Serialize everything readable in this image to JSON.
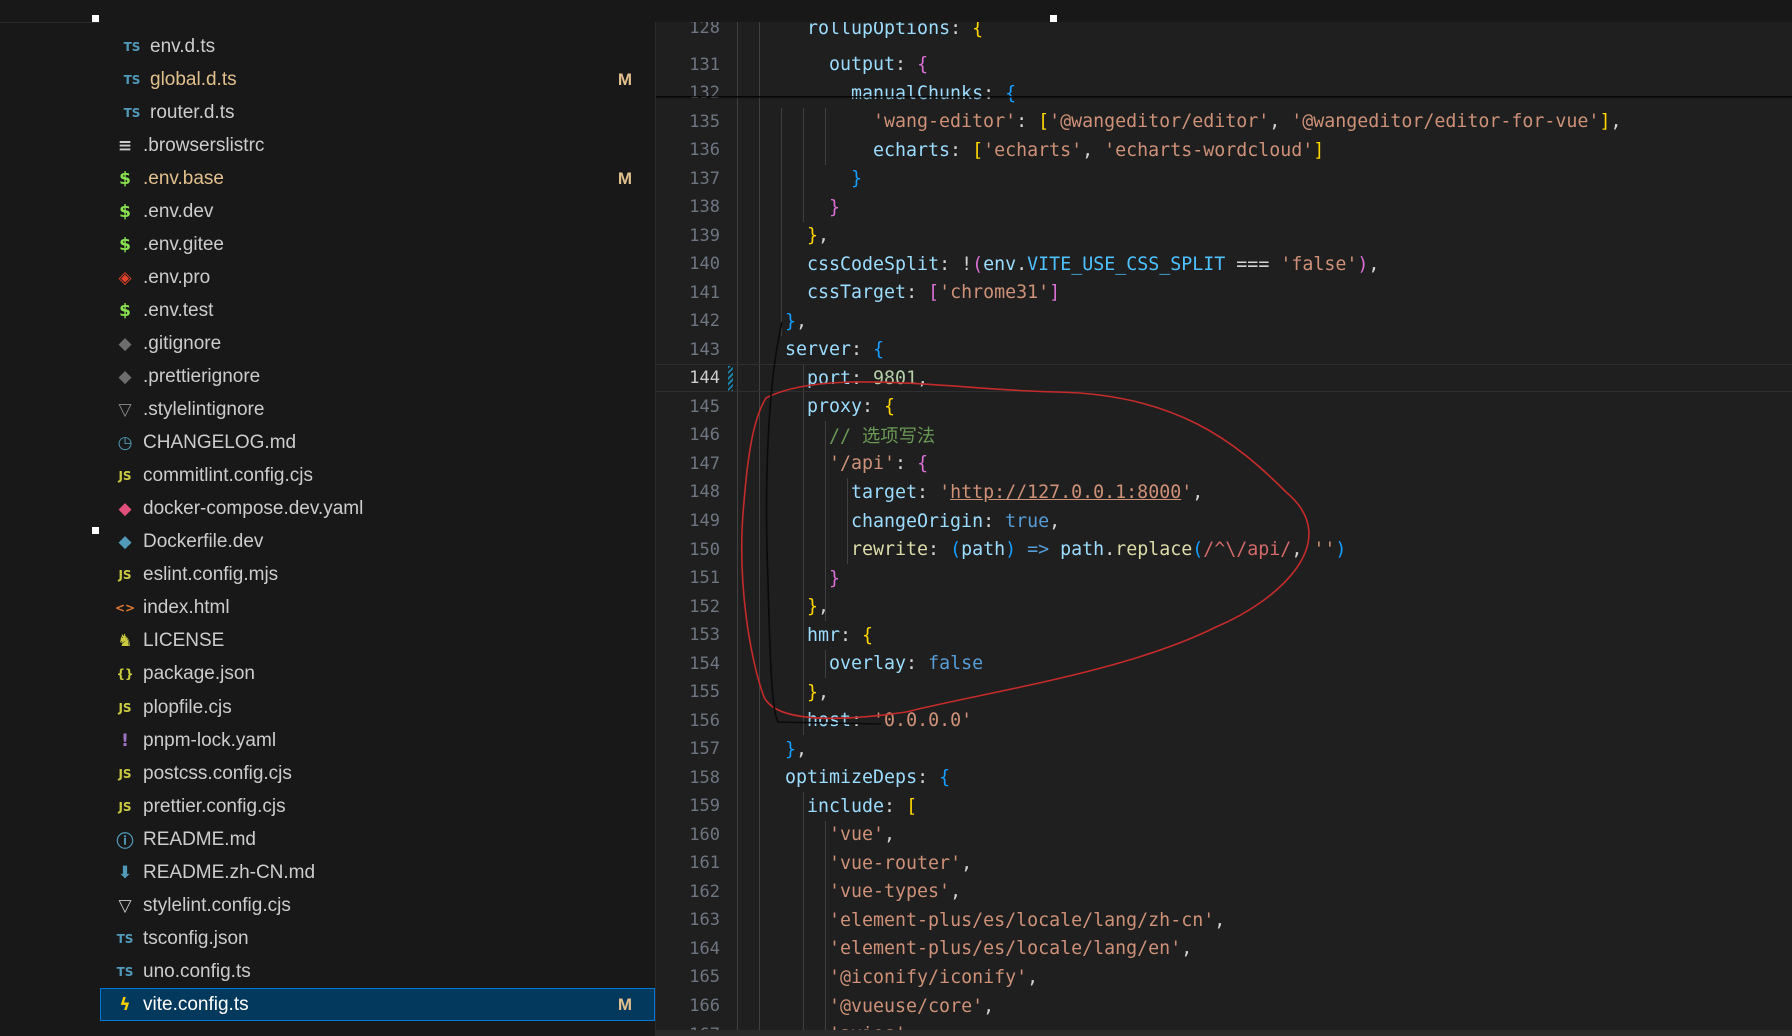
{
  "explorer": {
    "files": [
      {
        "icon": "ts-icon",
        "icon_text": "TS",
        "icon_color": "#519aba",
        "label": "env.d.ts",
        "nested": true,
        "modified": false,
        "badge": ""
      },
      {
        "icon": "ts-icon",
        "icon_text": "TS",
        "icon_color": "#519aba",
        "label": "global.d.ts",
        "nested": true,
        "modified": true,
        "badge": "M"
      },
      {
        "icon": "ts-icon",
        "icon_text": "TS",
        "icon_color": "#519aba",
        "label": "router.d.ts",
        "nested": true,
        "modified": false,
        "badge": ""
      },
      {
        "icon": "list-icon",
        "icon_text": "≡",
        "icon_color": "#cccccc",
        "label": ".browserslistrc",
        "nested": false,
        "modified": false,
        "badge": ""
      },
      {
        "icon": "dollar-icon",
        "icon_text": "$",
        "icon_color": "#89e051",
        "label": ".env.base",
        "nested": false,
        "modified": true,
        "badge": "M"
      },
      {
        "icon": "dollar-icon",
        "icon_text": "$",
        "icon_color": "#89e051",
        "label": ".env.dev",
        "nested": false,
        "modified": false,
        "badge": ""
      },
      {
        "icon": "dollar-icon",
        "icon_text": "$",
        "icon_color": "#89e051",
        "label": ".env.gitee",
        "nested": false,
        "modified": false,
        "badge": ""
      },
      {
        "icon": "gitlab-icon",
        "icon_text": "◈",
        "icon_color": "#e24329",
        "label": ".env.pro",
        "nested": false,
        "modified": false,
        "badge": ""
      },
      {
        "icon": "dollar-icon",
        "icon_text": "$",
        "icon_color": "#89e051",
        "label": ".env.test",
        "nested": false,
        "modified": false,
        "badge": ""
      },
      {
        "icon": "git-icon",
        "icon_text": "◆",
        "icon_color": "#6d6d6d",
        "label": ".gitignore",
        "nested": false,
        "modified": false,
        "badge": ""
      },
      {
        "icon": "prettier-icon",
        "icon_text": "◆",
        "icon_color": "#6d6d6d",
        "label": ".prettierignore",
        "nested": false,
        "modified": false,
        "badge": ""
      },
      {
        "icon": "stylelint-icon",
        "icon_text": "▽",
        "icon_color": "#8c8c8c",
        "label": ".stylelintignore",
        "nested": false,
        "modified": false,
        "badge": ""
      },
      {
        "icon": "history-icon",
        "icon_text": "◷",
        "icon_color": "#519aba",
        "label": "CHANGELOG.md",
        "nested": false,
        "modified": false,
        "badge": ""
      },
      {
        "icon": "js-icon",
        "icon_text": "JS",
        "icon_color": "#cbcb41",
        "label": "commitlint.config.cjs",
        "nested": false,
        "modified": false,
        "badge": ""
      },
      {
        "icon": "docker-compose-icon",
        "icon_text": "◆",
        "icon_color": "#e0507a",
        "label": "docker-compose.dev.yaml",
        "nested": false,
        "modified": false,
        "badge": ""
      },
      {
        "icon": "docker-icon",
        "icon_text": "◆",
        "icon_color": "#519aba",
        "label": "Dockerfile.dev",
        "nested": false,
        "modified": false,
        "badge": ""
      },
      {
        "icon": "js-icon",
        "icon_text": "JS",
        "icon_color": "#cbcb41",
        "label": "eslint.config.mjs",
        "nested": false,
        "modified": false,
        "badge": ""
      },
      {
        "icon": "html-icon",
        "icon_text": "<>",
        "icon_color": "#e37933",
        "label": "index.html",
        "nested": false,
        "modified": false,
        "badge": ""
      },
      {
        "icon": "license-icon",
        "icon_text": "♞",
        "icon_color": "#cbcb41",
        "label": "LICENSE",
        "nested": false,
        "modified": false,
        "badge": ""
      },
      {
        "icon": "json-icon",
        "icon_text": "{}",
        "icon_color": "#cbcb41",
        "label": "package.json",
        "nested": false,
        "modified": false,
        "badge": ""
      },
      {
        "icon": "js-icon",
        "icon_text": "JS",
        "icon_color": "#cbcb41",
        "label": "plopfile.cjs",
        "nested": false,
        "modified": false,
        "badge": ""
      },
      {
        "icon": "yaml-icon",
        "icon_text": "!",
        "icon_color": "#a074c4",
        "label": "pnpm-lock.yaml",
        "nested": false,
        "modified": false,
        "badge": ""
      },
      {
        "icon": "js-icon",
        "icon_text": "JS",
        "icon_color": "#cbcb41",
        "label": "postcss.config.cjs",
        "nested": false,
        "modified": false,
        "badge": ""
      },
      {
        "icon": "js-icon",
        "icon_text": "JS",
        "icon_color": "#cbcb41",
        "label": "prettier.config.cjs",
        "nested": false,
        "modified": false,
        "badge": ""
      },
      {
        "icon": "info-icon",
        "icon_text": "ⓘ",
        "icon_color": "#519aba",
        "label": "README.md",
        "nested": false,
        "modified": false,
        "badge": ""
      },
      {
        "icon": "download-icon",
        "icon_text": "⬇",
        "icon_color": "#519aba",
        "label": "README.zh-CN.md",
        "nested": false,
        "modified": false,
        "badge": ""
      },
      {
        "icon": "stylelint-icon",
        "icon_text": "▽",
        "icon_color": "#cccccc",
        "label": "stylelint.config.cjs",
        "nested": false,
        "modified": false,
        "badge": ""
      },
      {
        "icon": "tsconfig-icon",
        "icon_text": "TS",
        "icon_color": "#519aba",
        "label": "tsconfig.json",
        "nested": false,
        "modified": false,
        "badge": ""
      },
      {
        "icon": "ts-icon",
        "icon_text": "TS",
        "icon_color": "#519aba",
        "label": "uno.config.ts",
        "nested": false,
        "modified": false,
        "badge": ""
      },
      {
        "icon": "vite-icon",
        "icon_text": "ϟ",
        "icon_color": "#ffcf00",
        "label": "vite.config.ts",
        "nested": false,
        "modified": true,
        "badge": "M",
        "selected": true
      }
    ]
  },
  "editor": {
    "current_line": 144,
    "lines": [
      {
        "n": "128",
        "indent": 6,
        "tokens": [
          [
            "k",
            "rollupOptions"
          ],
          [
            "op",
            ": "
          ],
          [
            "b1",
            "{"
          ]
        ],
        "partial": true
      },
      {
        "n": "131",
        "indent": 8,
        "tokens": [
          [
            "k",
            "output"
          ],
          [
            "op",
            ": "
          ],
          [
            "b2",
            "{"
          ]
        ]
      },
      {
        "n": "132",
        "indent": 10,
        "tokens": [
          [
            "k",
            "manualChunks"
          ],
          [
            "op",
            ": "
          ],
          [
            "b3",
            "{"
          ]
        ]
      },
      {
        "n": "135",
        "indent": 12,
        "tokens": [
          [
            "s",
            "'wang-editor'"
          ],
          [
            "op",
            ": "
          ],
          [
            "b1",
            "["
          ],
          [
            "s",
            "'@wangeditor/editor'"
          ],
          [
            "op",
            ", "
          ],
          [
            "s",
            "'@wangeditor/editor-for-vue'"
          ],
          [
            "b1",
            "]"
          ],
          [
            "op",
            ","
          ]
        ]
      },
      {
        "n": "136",
        "indent": 12,
        "tokens": [
          [
            "k",
            "echarts"
          ],
          [
            "op",
            ": "
          ],
          [
            "b1",
            "["
          ],
          [
            "s",
            "'echarts'"
          ],
          [
            "op",
            ", "
          ],
          [
            "s",
            "'echarts-wordcloud'"
          ],
          [
            "b1",
            "]"
          ]
        ]
      },
      {
        "n": "137",
        "indent": 10,
        "tokens": [
          [
            "b3",
            "}"
          ]
        ]
      },
      {
        "n": "138",
        "indent": 8,
        "tokens": [
          [
            "b2",
            "}"
          ]
        ]
      },
      {
        "n": "139",
        "indent": 6,
        "tokens": [
          [
            "b1",
            "}"
          ],
          [
            "op",
            ","
          ]
        ]
      },
      {
        "n": "140",
        "indent": 6,
        "tokens": [
          [
            "k",
            "cssCodeSplit"
          ],
          [
            "op",
            ": !"
          ],
          [
            "b2",
            "("
          ],
          [
            "k",
            "env"
          ],
          [
            "op",
            "."
          ],
          [
            "cn",
            "VITE_USE_CSS_SPLIT"
          ],
          [
            "op",
            " === "
          ],
          [
            "s",
            "'false'"
          ],
          [
            "b2",
            ")"
          ],
          [
            "op",
            ","
          ]
        ]
      },
      {
        "n": "141",
        "indent": 6,
        "tokens": [
          [
            "k",
            "cssTarget"
          ],
          [
            "op",
            ": "
          ],
          [
            "b2",
            "["
          ],
          [
            "s",
            "'chrome31'"
          ],
          [
            "b2",
            "]"
          ]
        ]
      },
      {
        "n": "142",
        "indent": 4,
        "tokens": [
          [
            "b3",
            "}"
          ],
          [
            "op",
            ","
          ]
        ]
      },
      {
        "n": "143",
        "indent": 4,
        "tokens": [
          [
            "k",
            "server"
          ],
          [
            "op",
            ": "
          ],
          [
            "b3",
            "{"
          ]
        ]
      },
      {
        "n": "144",
        "indent": 6,
        "tokens": [
          [
            "k",
            "port"
          ],
          [
            "op",
            ": "
          ],
          [
            "num",
            "9801"
          ],
          [
            "op",
            ","
          ]
        ]
      },
      {
        "n": "145",
        "indent": 6,
        "tokens": [
          [
            "k",
            "proxy"
          ],
          [
            "op",
            ": "
          ],
          [
            "b1",
            "{"
          ]
        ]
      },
      {
        "n": "146",
        "indent": 8,
        "tokens": [
          [
            "cm",
            "// 选项写法"
          ]
        ]
      },
      {
        "n": "147",
        "indent": 8,
        "tokens": [
          [
            "s",
            "'/api'"
          ],
          [
            "op",
            ": "
          ],
          [
            "b2",
            "{"
          ]
        ]
      },
      {
        "n": "148",
        "indent": 10,
        "tokens": [
          [
            "k",
            "target"
          ],
          [
            "op",
            ": "
          ],
          [
            "s",
            "'"
          ],
          [
            "url",
            "http://127.0.0.1:8000"
          ],
          [
            "s",
            "'"
          ],
          [
            "op",
            ","
          ]
        ]
      },
      {
        "n": "149",
        "indent": 10,
        "tokens": [
          [
            "k",
            "changeOrigin"
          ],
          [
            "op",
            ": "
          ],
          [
            "kw",
            "true"
          ],
          [
            "op",
            ","
          ]
        ]
      },
      {
        "n": "150",
        "indent": 10,
        "tokens": [
          [
            "fn",
            "rewrite"
          ],
          [
            "op",
            ": "
          ],
          [
            "b3",
            "("
          ],
          [
            "pr",
            "path"
          ],
          [
            "b3",
            ")"
          ],
          [
            "kw",
            " => "
          ],
          [
            "pr",
            "path"
          ],
          [
            "op",
            "."
          ],
          [
            "fn",
            "replace"
          ],
          [
            "b3",
            "("
          ],
          [
            "rx",
            "/^\\/api/"
          ],
          [
            "op",
            ", "
          ],
          [
            "s",
            "''"
          ],
          [
            "b3",
            ")"
          ]
        ]
      },
      {
        "n": "151",
        "indent": 8,
        "tokens": [
          [
            "b2",
            "}"
          ]
        ]
      },
      {
        "n": "152",
        "indent": 6,
        "tokens": [
          [
            "b1",
            "}"
          ],
          [
            "op",
            ","
          ]
        ]
      },
      {
        "n": "153",
        "indent": 6,
        "tokens": [
          [
            "k",
            "hmr"
          ],
          [
            "op",
            ": "
          ],
          [
            "b1",
            "{"
          ]
        ]
      },
      {
        "n": "154",
        "indent": 8,
        "tokens": [
          [
            "k",
            "overlay"
          ],
          [
            "op",
            ": "
          ],
          [
            "kw",
            "false"
          ]
        ]
      },
      {
        "n": "155",
        "indent": 6,
        "tokens": [
          [
            "b1",
            "}"
          ],
          [
            "op",
            ","
          ]
        ]
      },
      {
        "n": "156",
        "indent": 6,
        "tokens": [
          [
            "k",
            "host"
          ],
          [
            "op",
            ": "
          ],
          [
            "s",
            "'0.0.0.0'"
          ]
        ]
      },
      {
        "n": "157",
        "indent": 4,
        "tokens": [
          [
            "b3",
            "}"
          ],
          [
            "op",
            ","
          ]
        ]
      },
      {
        "n": "158",
        "indent": 4,
        "tokens": [
          [
            "k",
            "optimizeDeps"
          ],
          [
            "op",
            ": "
          ],
          [
            "b3",
            "{"
          ]
        ]
      },
      {
        "n": "159",
        "indent": 6,
        "tokens": [
          [
            "k",
            "include"
          ],
          [
            "op",
            ": "
          ],
          [
            "b1",
            "["
          ]
        ]
      },
      {
        "n": "160",
        "indent": 8,
        "tokens": [
          [
            "s",
            "'vue'"
          ],
          [
            "op",
            ","
          ]
        ]
      },
      {
        "n": "161",
        "indent": 8,
        "tokens": [
          [
            "s",
            "'vue-router'"
          ],
          [
            "op",
            ","
          ]
        ]
      },
      {
        "n": "162",
        "indent": 8,
        "tokens": [
          [
            "s",
            "'vue-types'"
          ],
          [
            "op",
            ","
          ]
        ]
      },
      {
        "n": "163",
        "indent": 8,
        "tokens": [
          [
            "s",
            "'element-plus/es/locale/lang/zh-cn'"
          ],
          [
            "op",
            ","
          ]
        ]
      },
      {
        "n": "164",
        "indent": 8,
        "tokens": [
          [
            "s",
            "'element-plus/es/locale/lang/en'"
          ],
          [
            "op",
            ","
          ]
        ]
      },
      {
        "n": "165",
        "indent": 8,
        "tokens": [
          [
            "s",
            "'@iconify/iconify'"
          ],
          [
            "op",
            ","
          ]
        ]
      },
      {
        "n": "166",
        "indent": 8,
        "tokens": [
          [
            "s",
            "'@vueuse/core'"
          ],
          [
            "op",
            ","
          ]
        ]
      },
      {
        "n": "167",
        "indent": 8,
        "tokens": [
          [
            "s",
            "'axios'"
          ],
          [
            "op",
            ","
          ]
        ],
        "partial": true
      }
    ]
  }
}
